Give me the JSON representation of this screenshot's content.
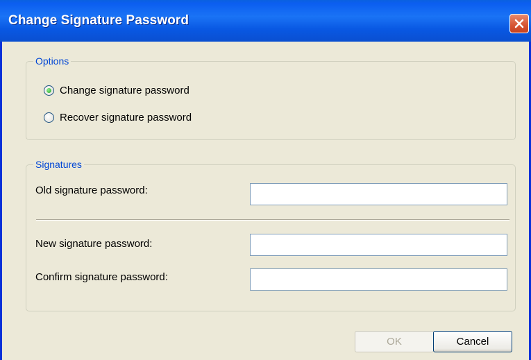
{
  "window": {
    "title": "Change Signature Password"
  },
  "options_group": {
    "legend": "Options",
    "radios": [
      {
        "label": "Change signature password",
        "checked": true
      },
      {
        "label": "Recover signature password",
        "checked": false
      }
    ]
  },
  "signatures_group": {
    "legend": "Signatures",
    "old_password_label": "Old signature password:",
    "new_password_label": "New signature password:",
    "confirm_password_label": "Confirm signature password:",
    "old_password_value": "",
    "new_password_value": "",
    "confirm_password_value": ""
  },
  "buttons": {
    "ok_label": "OK",
    "ok_enabled": false,
    "cancel_label": "Cancel"
  },
  "icons": {
    "close": "close-icon"
  },
  "colors": {
    "titlebar": "#0a5ee8",
    "group_legend": "#0046d5",
    "dialog_bg": "#ece9d8"
  }
}
